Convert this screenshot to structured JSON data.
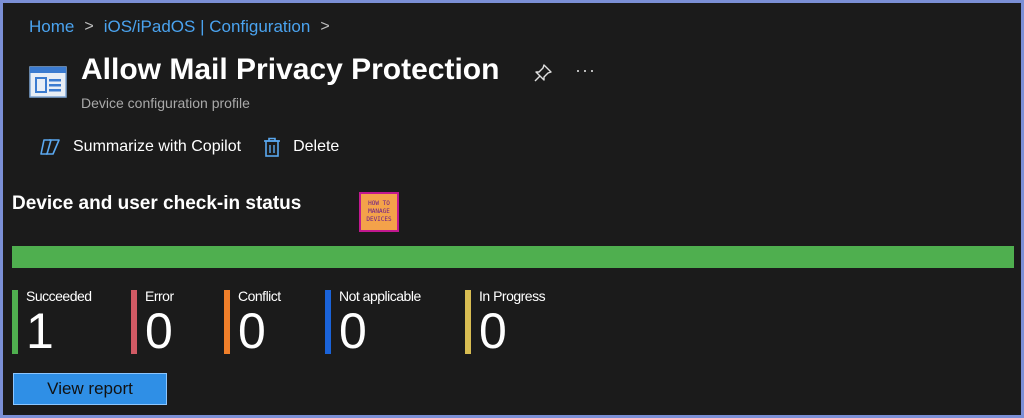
{
  "breadcrumb": {
    "items": [
      "Home",
      "iOS/iPadOS | Configuration"
    ],
    "separator": ">"
  },
  "header": {
    "title": "Allow Mail Privacy Protection",
    "subtitle": "Device configuration profile",
    "more_label": "···"
  },
  "toolbar": {
    "copilot_label": "Summarize with Copilot",
    "delete_label": "Delete"
  },
  "status": {
    "section_title": "Device and user check-in status",
    "logo_lines": [
      "HOW TO",
      "MANAGE",
      "DEVICES"
    ],
    "progress_fraction": 1.0,
    "stats": [
      {
        "label": "Succeeded",
        "value": "1",
        "color": "#4faf4f"
      },
      {
        "label": "Error",
        "value": "0",
        "color": "#d05a64"
      },
      {
        "label": "Conflict",
        "value": "0",
        "color": "#f07f2a"
      },
      {
        "label": "Not applicable",
        "value": "0",
        "color": "#1a63d9"
      },
      {
        "label": "In Progress",
        "value": "0",
        "color": "#d8bd52"
      }
    ]
  },
  "actions": {
    "view_report_label": "View report"
  },
  "colors": {
    "accent": "#4aa3ef",
    "button": "#2f8fe6",
    "progress": "#4faf4f"
  }
}
